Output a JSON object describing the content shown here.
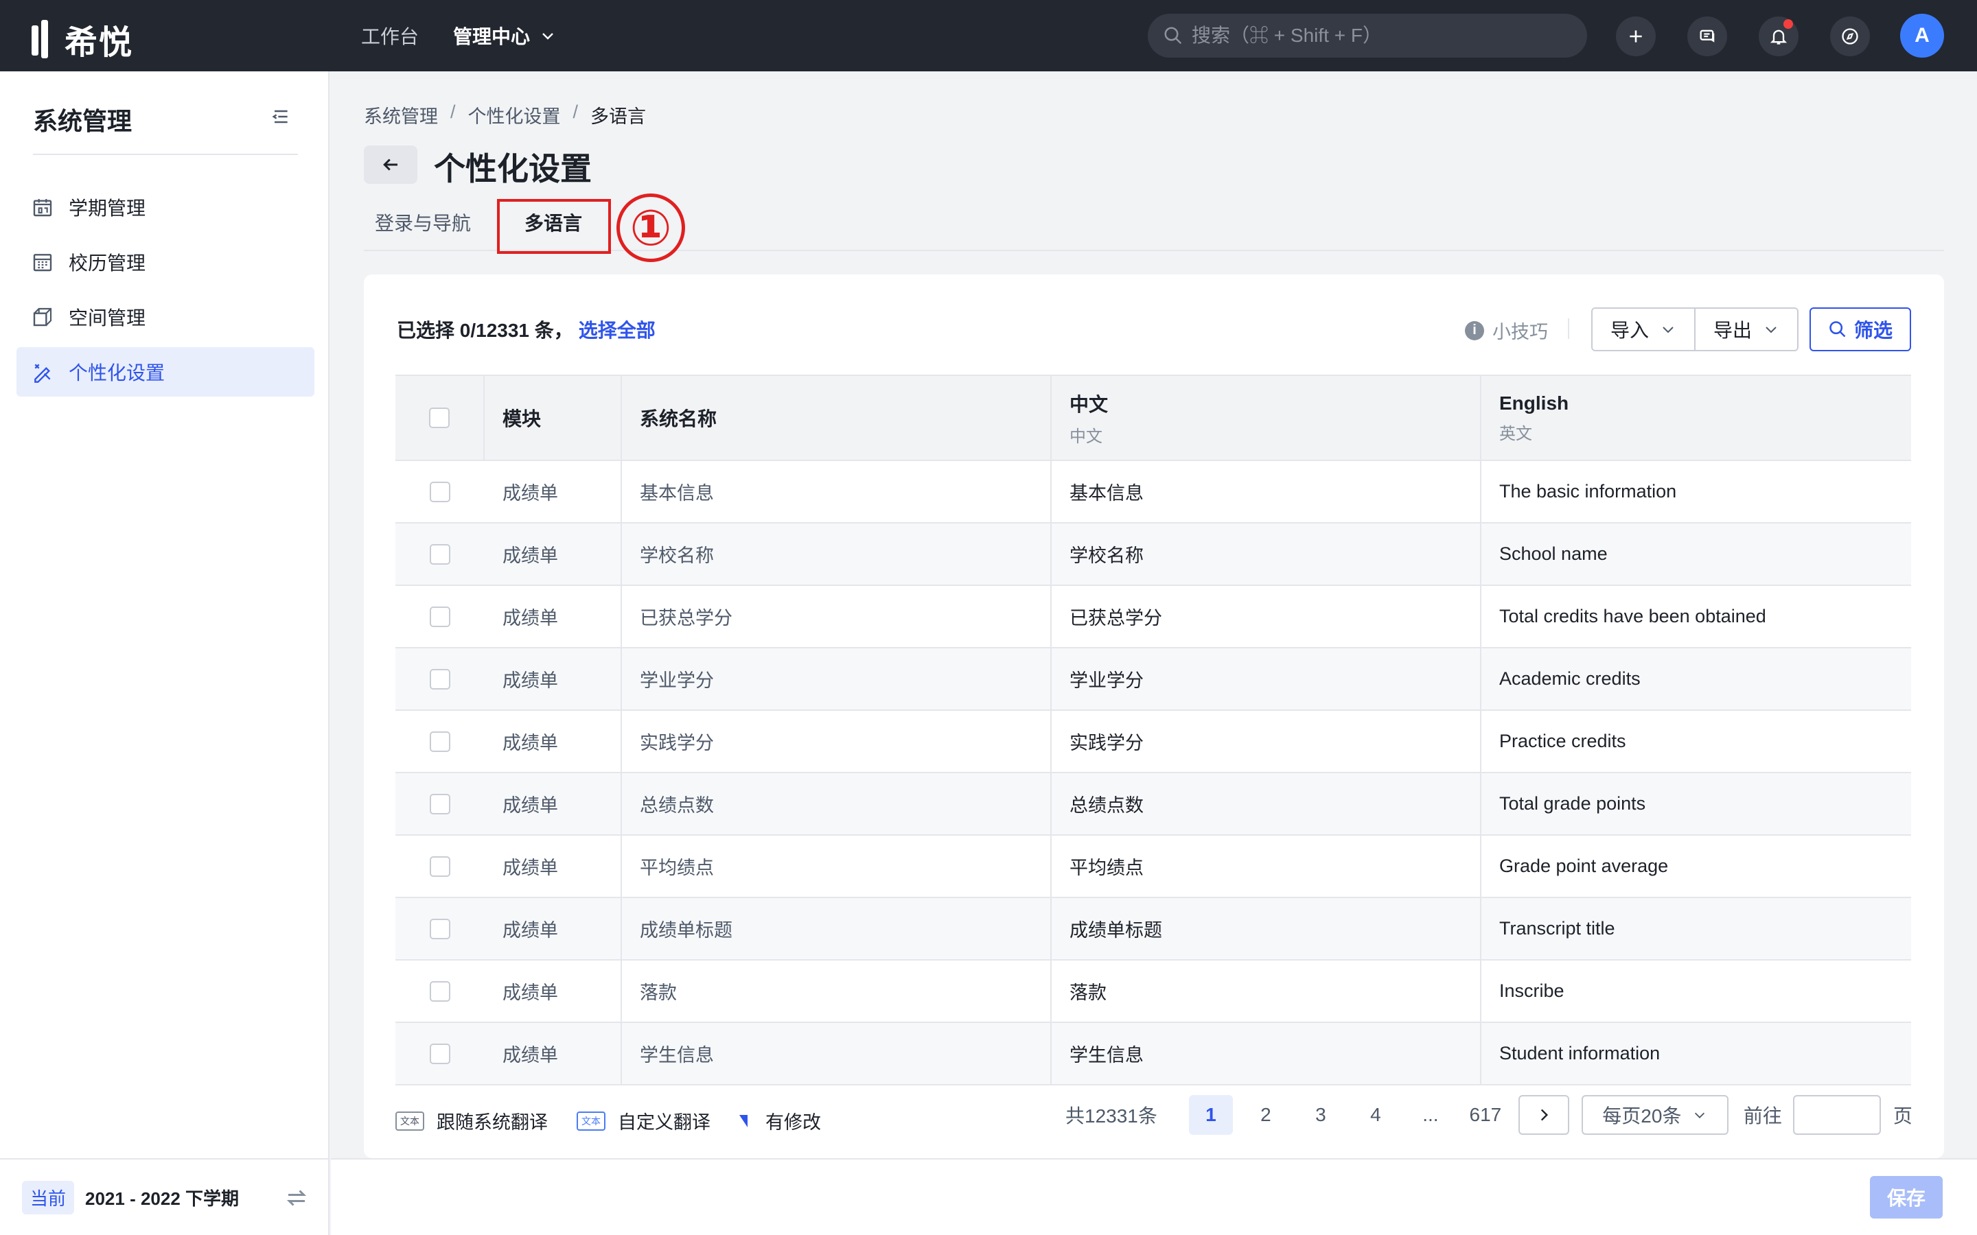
{
  "app": {
    "logo_text": "希悦"
  },
  "topnav": {
    "items": [
      {
        "label": "工作台"
      },
      {
        "label": "管理中心"
      }
    ]
  },
  "search": {
    "placeholder": "搜索（⌘ + Shift + F）"
  },
  "user": {
    "avatar_letter": "A"
  },
  "sidebar": {
    "title": "系统管理",
    "items": [
      {
        "label": "学期管理",
        "icon": "calendar-icon"
      },
      {
        "label": "校历管理",
        "icon": "grid-calendar-icon"
      },
      {
        "label": "空间管理",
        "icon": "cube-icon"
      },
      {
        "label": "个性化设置",
        "icon": "brush-ruler-icon",
        "active": true
      }
    ],
    "footer": {
      "badge": "当前",
      "term": "2021 - 2022 下学期"
    }
  },
  "breadcrumb": [
    "系统管理",
    "个性化设置",
    "多语言"
  ],
  "page": {
    "title": "个性化设置"
  },
  "tabs": [
    {
      "label": "登录与导航"
    },
    {
      "label": "多语言",
      "active": true
    }
  ],
  "annotation": {
    "marker": "①",
    "color": "#e02020"
  },
  "toolbar": {
    "selected_text": "已选择 0/12331 条，",
    "select_all": "选择全部",
    "tip": "小技巧",
    "import": "导入",
    "export": "导出",
    "filter": "筛选"
  },
  "table": {
    "headers": [
      {
        "title": "模块",
        "sub": ""
      },
      {
        "title": "系统名称",
        "sub": ""
      },
      {
        "title": "中文",
        "sub": "中文"
      },
      {
        "title": "English",
        "sub": "英文"
      }
    ],
    "rows": [
      {
        "module": "成绩单",
        "system": "基本信息",
        "zh": "基本信息",
        "en": "The basic information"
      },
      {
        "module": "成绩单",
        "system": "学校名称",
        "zh": "学校名称",
        "en": "School name"
      },
      {
        "module": "成绩单",
        "system": "已获总学分",
        "zh": "已获总学分",
        "en": "Total credits have been obtained"
      },
      {
        "module": "成绩单",
        "system": "学业学分",
        "zh": "学业学分",
        "en": "Academic credits"
      },
      {
        "module": "成绩单",
        "system": "实践学分",
        "zh": "实践学分",
        "en": "Practice credits"
      },
      {
        "module": "成绩单",
        "system": "总绩点数",
        "zh": "总绩点数",
        "en": "Total grade points"
      },
      {
        "module": "成绩单",
        "system": "平均绩点",
        "zh": "平均绩点",
        "en": "Grade point average"
      },
      {
        "module": "成绩单",
        "system": "成绩单标题",
        "zh": "成绩单标题",
        "en": "Transcript title"
      },
      {
        "module": "成绩单",
        "system": "落款",
        "zh": "落款",
        "en": "Inscribe"
      },
      {
        "module": "成绩单",
        "system": "学生信息",
        "zh": "学生信息",
        "en": "Student information"
      }
    ]
  },
  "legend": {
    "tag_text": "文本",
    "items": [
      {
        "label": "跟随系统翻译"
      },
      {
        "label": "自定义翻译"
      },
      {
        "label": "有修改"
      }
    ]
  },
  "pagination": {
    "total": "共12331条",
    "pages": [
      "1",
      "2",
      "3",
      "4",
      "...",
      "617"
    ],
    "current": "1",
    "page_size": "每页20条",
    "goto_label": "前往",
    "goto_suffix": "页",
    "goto_value": ""
  },
  "footer": {
    "save": "保存"
  },
  "colors": {
    "primary": "#2f54eb",
    "topbar": "#232730",
    "annotation": "#e02020"
  }
}
